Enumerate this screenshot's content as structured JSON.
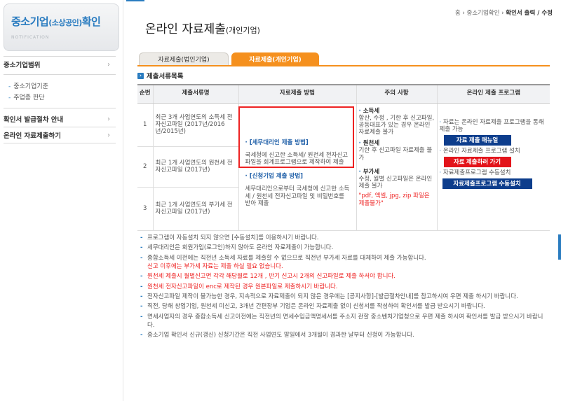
{
  "sidebar": {
    "brand_main": "중소기업",
    "brand_small": "(소상공인)",
    "brand_tail": "확인",
    "brand_sub": "NOTIFICATION",
    "menu": [
      {
        "label": "중소기업범위"
      },
      {
        "label": "확인서 발급절차 안내"
      },
      {
        "label": "온라인 자료제출하기"
      }
    ],
    "submenu": [
      "중소기업기준",
      "주업종 판단"
    ]
  },
  "breadcrumb": {
    "home": "홈",
    "sep": "›",
    "section": "중소기업확인",
    "current": "확인서 출력 / 수정"
  },
  "page_title": {
    "main": "온라인 자료제출",
    "sub": "(개인기업)"
  },
  "tabs": {
    "corp": "자료제출(법인기업)",
    "indiv": "자료제출(개인기업)"
  },
  "section_title": "제출서류목록",
  "table": {
    "headers": [
      "순번",
      "제출서류명",
      "자료제출 방법",
      "주의 사항",
      "온라인 제출 프로그램"
    ],
    "rows": [
      {
        "num": "1",
        "doc": "최근 3개 사업연도의 소득세 전자신고파일 (2017년/2016년/2015년)"
      },
      {
        "num": "2",
        "doc": "최근 1개 사업연도의 원천세 전자신고파일 (2017년)"
      },
      {
        "num": "3",
        "doc": "최근 1개 사업연도의 부가세 전자신고파일 (2017년)"
      }
    ],
    "method": {
      "m1_title": "[세무대리인 제출 방법]",
      "m1_body": "국세청에 신고한 소득세/ 원천세 전자신고파일을 회계프로그램으로 제작하여 제출",
      "m2_title": "[신청기업 제출 방법]",
      "m2_body": "세무대리인으로부터 국세청에 신고한 소득세 / 원천세 전자신고파일 및 비밀번호를 받아 제출"
    },
    "caution": {
      "c1_title": "소득세",
      "c1_body": "합산, 수정 , 기한 후 신고파일, 공동대표가 있는 경우 온라인 자료제출 불가",
      "c2_title": "원천세",
      "c2_body": "기한 후 신고파일 자료제출 불가",
      "c3_title": "부가세",
      "c3_body": "수정, 월별 신고파일은 온라인 제출 불가",
      "c3_red": "\"pdf, 엑셀, jpg, zip 파일은 제출불가\""
    },
    "program": {
      "p1_text": "자료는 온라인 자료제출 프로그램을 통해 제출 가능",
      "p1_btn": "자료 제출 매뉴얼",
      "p2_text": "온라인 자료제출 프로그램 설치",
      "p2_btn": "자료 제출하러 가기",
      "p3_text": "자료제출프로그램 수동설치",
      "p3_btn": "자료제출프로그램 수동설치"
    }
  },
  "notes": [
    {
      "text": "프로그램이 자동설치 되지 않으면 [수동설치]를 이용하시기 바랍니다."
    },
    {
      "text": "세무대리인은 회원가입(로그인)하지 않아도 온라인 자료제출이 가능합니다."
    },
    {
      "text": "종합소득세 이전에는 직전년 소득세 자료를 제출할 수 없으므로 직전년 부가세 자료를 대체하여 제출 가능합니다.",
      "red": "신고 이후에는 부가세 자료는 제출 하실 필요 없습니다."
    },
    {
      "text_red": "원천세 제출시 월별신고면 각각 해당월로 12개 , 반기 신고시 2개의 신고파일로 제출 하셔야 합니다."
    },
    {
      "text_red": "원천세 전자신고파일이 enc로 제작된 경우 원본파일로 제출하시기 바랍니다."
    },
    {
      "text": "전자신고파일 제작이 불가능한 경우, 지속적으로 자료제출이 되지 않은 경우에는 [공지사항]-[발급절차안내]를 참고하시여 우편 제출 하시기 바랍니다."
    },
    {
      "text": "직전, 당해 창업기업, 원천세 미신고, 3개년 간편장부 기업은 온라인 자료제출 없이 신청서를 작성하여 확인서를 발급 받으시기 바랍니다."
    },
    {
      "text": "면세사업자의 경우 종합소득세 신고이전에는 직전년의 면세수입금액명세서를 주소지 관할 중소벤처기업청으로 우편 제출 하시여 확인서를 발급 받으시기 바랍니다."
    },
    {
      "text": "중소기업 확인서 신규(갱신) 신청기간은 직전 사업연도 말일에서 3개월이 경과한 날부터 신청이 가능합니다."
    }
  ],
  "colors": {
    "brand_blue": "#2a7cc0",
    "tab_orange": "#f5901e",
    "btn_navy": "#0d3d8c",
    "btn_red": "#e3141b",
    "alert_red": "#e22222"
  }
}
